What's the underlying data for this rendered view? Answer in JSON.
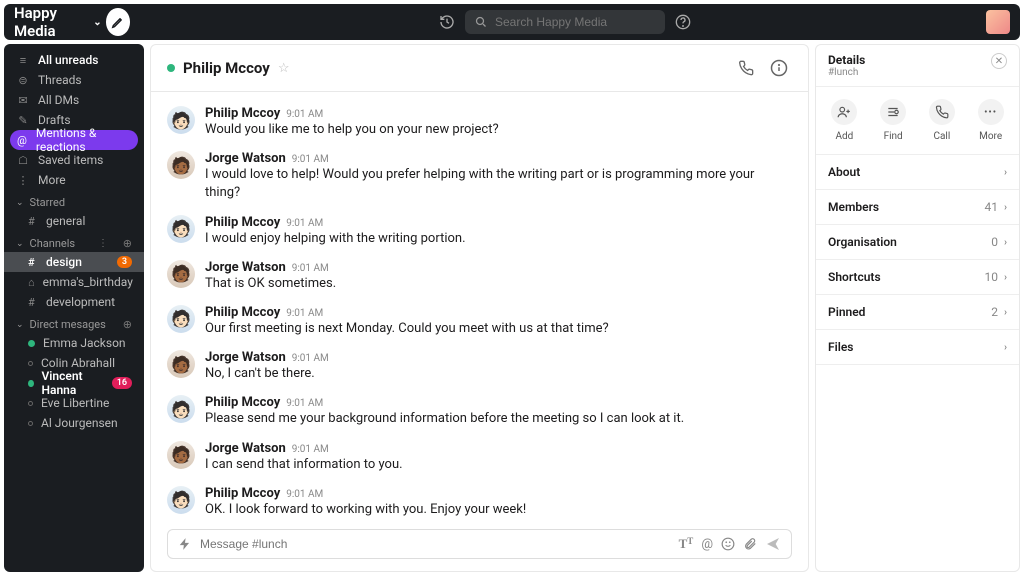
{
  "workspace": {
    "name": "Happy Media"
  },
  "search": {
    "placeholder": "Search Happy Media"
  },
  "sidebar": {
    "items": [
      {
        "label": "All unreads",
        "icon": "≡"
      },
      {
        "label": "Threads",
        "icon": "⊜"
      },
      {
        "label": "All DMs",
        "icon": "✉"
      },
      {
        "label": "Drafts",
        "icon": "✎"
      },
      {
        "label": "Mentions & reactions",
        "icon": "@"
      },
      {
        "label": "Saved items",
        "icon": "☖"
      },
      {
        "label": "More",
        "icon": "⋮"
      }
    ],
    "sections": {
      "starred": {
        "label": "Starred",
        "channels": [
          {
            "name": "general",
            "prefix": "#"
          }
        ]
      },
      "channels": {
        "label": "Channels",
        "channels": [
          {
            "name": "design",
            "prefix": "#",
            "badge": "3",
            "selected": true
          },
          {
            "name": "emma's_birthday",
            "prefix": "⌂"
          },
          {
            "name": "development",
            "prefix": "#"
          }
        ]
      },
      "dms": {
        "label": "Direct mesages",
        "items": [
          {
            "name": "Emma Jackson",
            "online": true
          },
          {
            "name": "Colin Abrahall",
            "online": false
          },
          {
            "name": "Vincent Hanna",
            "online": true,
            "bold": true,
            "badge": "16"
          },
          {
            "name": "Eve Libertine",
            "online": false
          },
          {
            "name": "Al Jourgensen",
            "online": false
          }
        ]
      }
    }
  },
  "conversation": {
    "title": "Philip Mccoy",
    "messages": [
      {
        "author": "Philip Mccoy",
        "time": "9:01 AM",
        "text": "Would you like me to help you on your new project?",
        "av": "pm"
      },
      {
        "author": "Jorge Watson",
        "time": "9:01 AM",
        "text": "I would love to help! Would you prefer helping with the writing part or is programming more your thing?",
        "av": "jw"
      },
      {
        "author": "Philip Mccoy",
        "time": "9:01 AM",
        "text": "I would enjoy helping with the writing portion.",
        "av": "pm"
      },
      {
        "author": "Jorge Watson",
        "time": "9:01 AM",
        "text": "That is OK sometimes.",
        "av": "jw"
      },
      {
        "author": "Philip Mccoy",
        "time": "9:01 AM",
        "text": "Our first meeting is next Monday. Could you meet with us at that time?",
        "av": "pm"
      },
      {
        "author": "Jorge Watson",
        "time": "9:01 AM",
        "text": "No, I can't be there.",
        "av": "jw"
      },
      {
        "author": "Philip Mccoy",
        "time": "9:01 AM",
        "text": "Please send me your background information before the meeting so I can look at it.",
        "av": "pm"
      },
      {
        "author": "Jorge Watson",
        "time": "9:01 AM",
        "text": "I can send that information to you.",
        "av": "jw"
      },
      {
        "author": "Philip Mccoy",
        "time": "9:01 AM",
        "text": "OK. I look forward to working with you. Enjoy your week!",
        "av": "pm"
      }
    ]
  },
  "composer": {
    "placeholder": "Message #lunch"
  },
  "details": {
    "title": "Details",
    "subtitle": "#lunch",
    "actions": [
      {
        "label": "Add",
        "icon": "add"
      },
      {
        "label": "Find",
        "icon": "find"
      },
      {
        "label": "Call",
        "icon": "call"
      },
      {
        "label": "More",
        "icon": "more"
      }
    ],
    "rows": [
      {
        "label": "About"
      },
      {
        "label": "Members",
        "count": "41"
      },
      {
        "label": "Organisation",
        "count": "0"
      },
      {
        "label": "Shortcuts",
        "count": "10"
      },
      {
        "label": "Pinned",
        "count": "2"
      },
      {
        "label": "Files"
      }
    ]
  }
}
